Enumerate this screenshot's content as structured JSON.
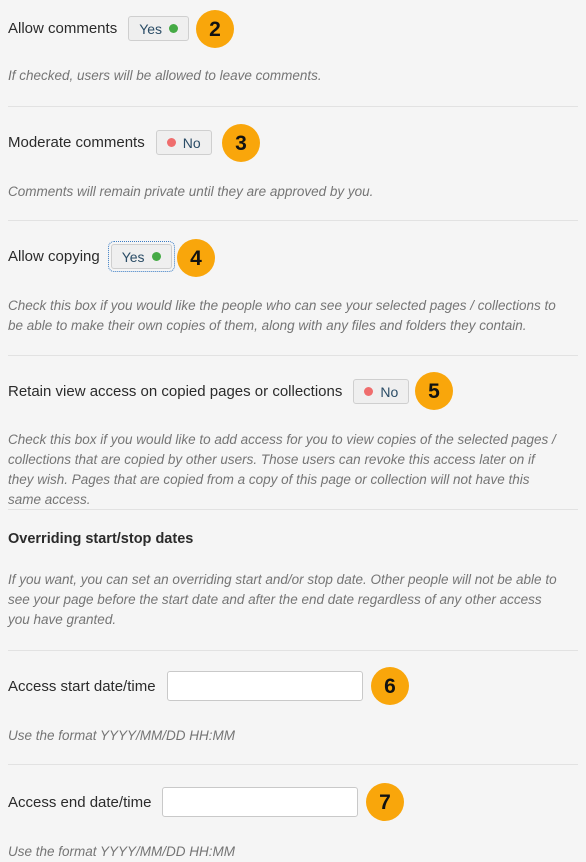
{
  "page": {
    "background_color": "#f5f5f5",
    "badge_color": "#f9a60b",
    "toggle_on_color": "#45aa45",
    "toggle_off_color": "#ef6d6d"
  },
  "fields": [
    {
      "label": "Allow comments",
      "control": "toggle",
      "value": "Yes",
      "state": "on",
      "focused": false,
      "badge": "2",
      "help": "If checked, users will be allowed to leave comments."
    },
    {
      "label": "Moderate comments",
      "control": "toggle",
      "value": "No",
      "state": "off",
      "focused": false,
      "badge": "3",
      "help": "Comments will remain private until they are approved by you."
    },
    {
      "label": "Allow copying",
      "control": "toggle",
      "value": "Yes",
      "state": "on",
      "focused": true,
      "badge": "4",
      "help": "Check this box if you would like the people who can see your selected pages / collections to be able to make their own copies of them, along with any files and folders they contain."
    },
    {
      "label": "Retain view access on copied pages or collections",
      "control": "toggle",
      "value": "No",
      "state": "off",
      "focused": false,
      "badge": "5",
      "help": "Check this box if you would like to add access for you to view copies of the selected pages / collections that are copied by other users. Those users can revoke this access later on if they wish. Pages that are copied from a copy of this page or collection will not have this same access."
    }
  ],
  "override_section": {
    "heading": "Overriding start/stop dates",
    "description": "If you want, you can set an overriding start and/or stop date. Other people will not be able to see your page before the start date and after the end date regardless of any other access you have granted."
  },
  "date_fields": [
    {
      "label": "Access start date/time",
      "control": "text",
      "value": "",
      "placeholder": "",
      "badge": "6",
      "help": "Use the format YYYY/MM/DD HH:MM"
    },
    {
      "label": "Access end date/time",
      "control": "text",
      "value": "",
      "placeholder": "",
      "badge": "7",
      "help": "Use the format YYYY/MM/DD HH:MM"
    }
  ]
}
